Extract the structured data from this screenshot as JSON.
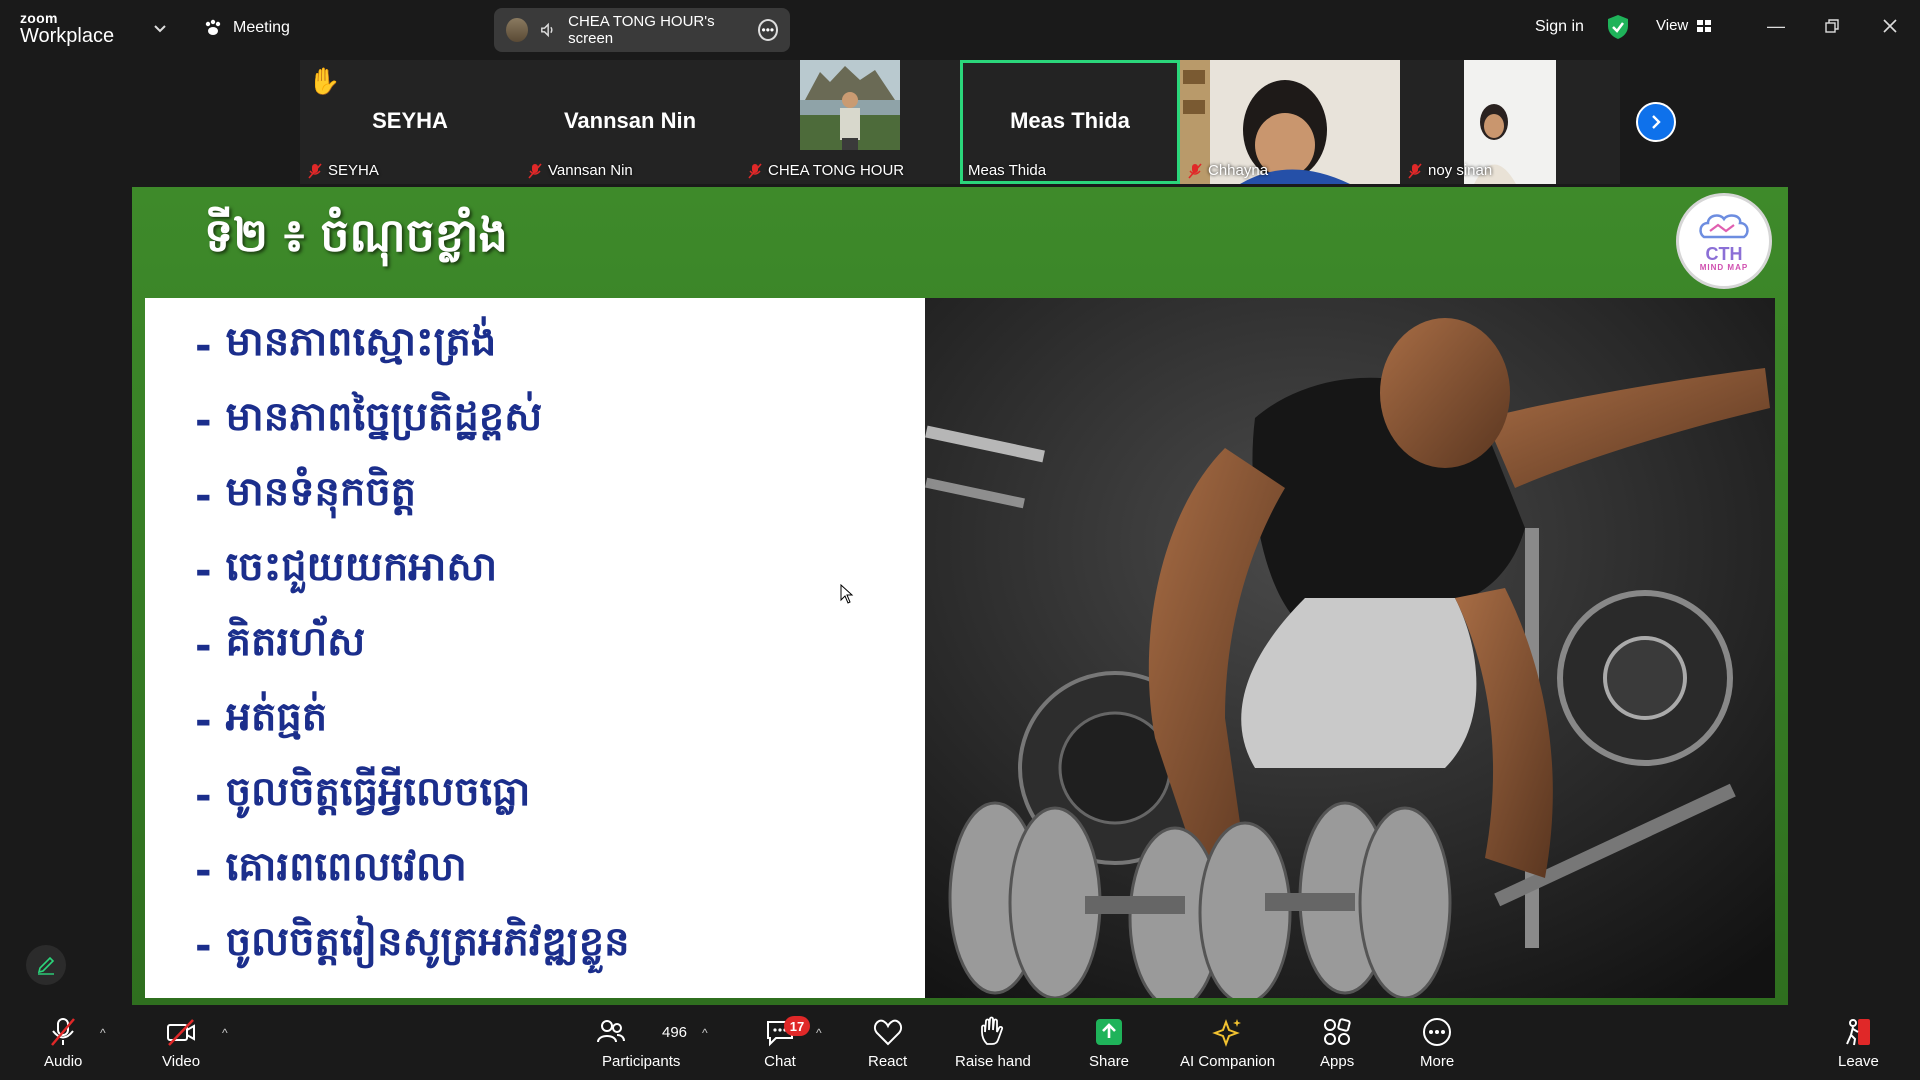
{
  "app": {
    "brand_small": "zoom",
    "brand_big": "Workplace",
    "meeting_label": "Meeting"
  },
  "share_bar": {
    "text": "CHEA TONG HOUR's screen"
  },
  "top_right": {
    "signin": "Sign in",
    "view": "View"
  },
  "participants": [
    {
      "name": "SEYHA",
      "display": "SEYHA",
      "muted": true,
      "hand_raised": true,
      "video": false
    },
    {
      "name": "Vannsan Nin",
      "display": "Vannsan Nin",
      "muted": true,
      "video": false
    },
    {
      "name": "CHEA TONG HOUR",
      "display": "",
      "muted": true,
      "video": true
    },
    {
      "name": "Meas Thida",
      "display": "Meas Thida",
      "muted": false,
      "video": false,
      "active_speaker": true
    },
    {
      "name": "Chhayna",
      "display": "",
      "muted": true,
      "video": true
    },
    {
      "name": "noy sinan",
      "display": "",
      "muted": true,
      "video": true
    }
  ],
  "slide": {
    "title": "ទី២ ៖ ចំណុចខ្លាំង",
    "logo_text": "CTH",
    "logo_subtext": "MIND MAP",
    "bullets": [
      "មានភាពស្មោះត្រង់",
      "មានភាពច្នៃប្រតិដ្ឋខ្ពស់",
      "មានទំនុកចិត្ត",
      "ចេះជួយយកអាសា",
      "គិតរហ័ស",
      "អត់ធ្មត់",
      "ចូលចិត្តធ្វើអ្វីលេចធ្លោ",
      "គោរពពេលវេលា",
      "ចូលចិត្តរៀនសូត្រអភិវឌ្ឍខ្លួន"
    ],
    "bullet_marker": "-"
  },
  "toolbar": {
    "audio": "Audio",
    "video": "Video",
    "participants": "Participants",
    "participant_count": "496",
    "chat": "Chat",
    "chat_badge": "17",
    "react": "React",
    "raise_hand": "Raise hand",
    "share": "Share",
    "ai_companion": "AI Companion",
    "apps": "Apps",
    "more": "More",
    "leave": "Leave"
  },
  "colors": {
    "active_border": "#2bd67b",
    "share_green": "#1fb35a",
    "leave_red": "#e02828",
    "slide_green": "#3e8a2a",
    "bullet_blue": "#1b2e8c"
  }
}
